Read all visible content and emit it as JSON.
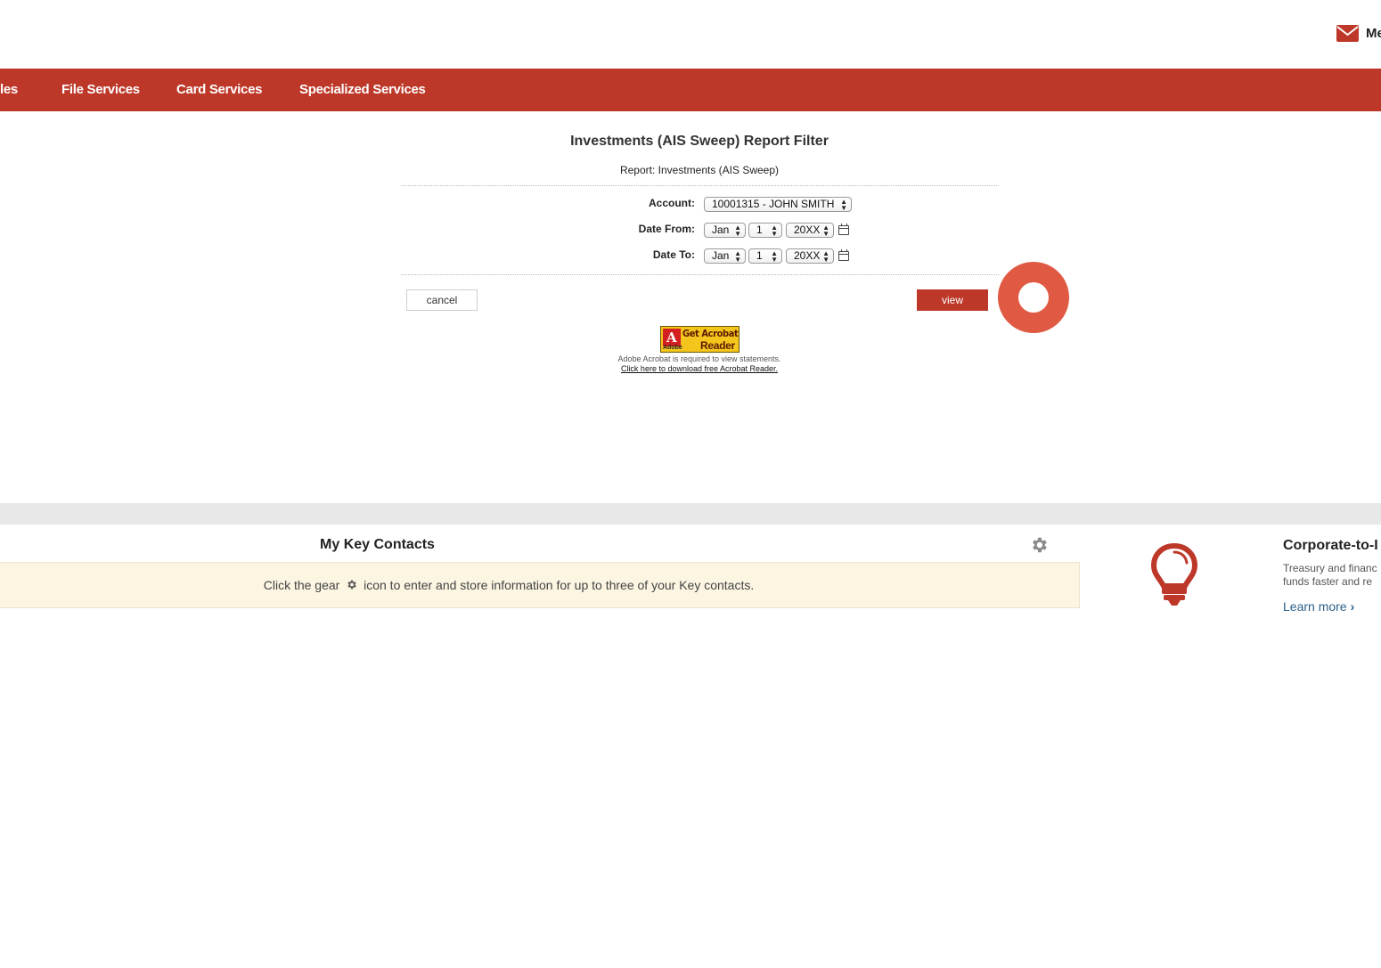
{
  "header": {
    "mail_label": "Me",
    "mail_icon": "envelope-icon"
  },
  "nav": {
    "items": [
      "les",
      "File Services",
      "Card Services",
      "Specialized Services"
    ],
    "color": "#bd3829"
  },
  "report_filter": {
    "title": "Investments (AIS Sweep) Report Filter",
    "subtitle": "Report: Investments (AIS Sweep)",
    "account": {
      "label": "Account:",
      "value": "10001315 - JOHN SMITH"
    },
    "date_from": {
      "label": "Date From:",
      "month": "Jan",
      "day": "1",
      "year": "20XX"
    },
    "date_to": {
      "label": "Date To:",
      "month": "Jan",
      "day": "1",
      "year": "20XX"
    },
    "cancel_label": "cancel",
    "view_label": "view",
    "acrobat": {
      "badge_line1": "Get Acrobat",
      "badge_line2": "Reader",
      "badge_brand": "Adobe",
      "note": "Adobe Acrobat is required to view statements.",
      "link": "Click here to download free Acrobat Reader."
    }
  },
  "key_contacts": {
    "title": "My Key Contacts",
    "message_before": "Click the gear",
    "message_after": "icon to enter and store information for up to three of your Key contacts."
  },
  "promo": {
    "title": "Corporate-to-I",
    "text_line1": "Treasury and financ",
    "text_line2": "funds faster and re",
    "learn_more": "Learn more"
  }
}
